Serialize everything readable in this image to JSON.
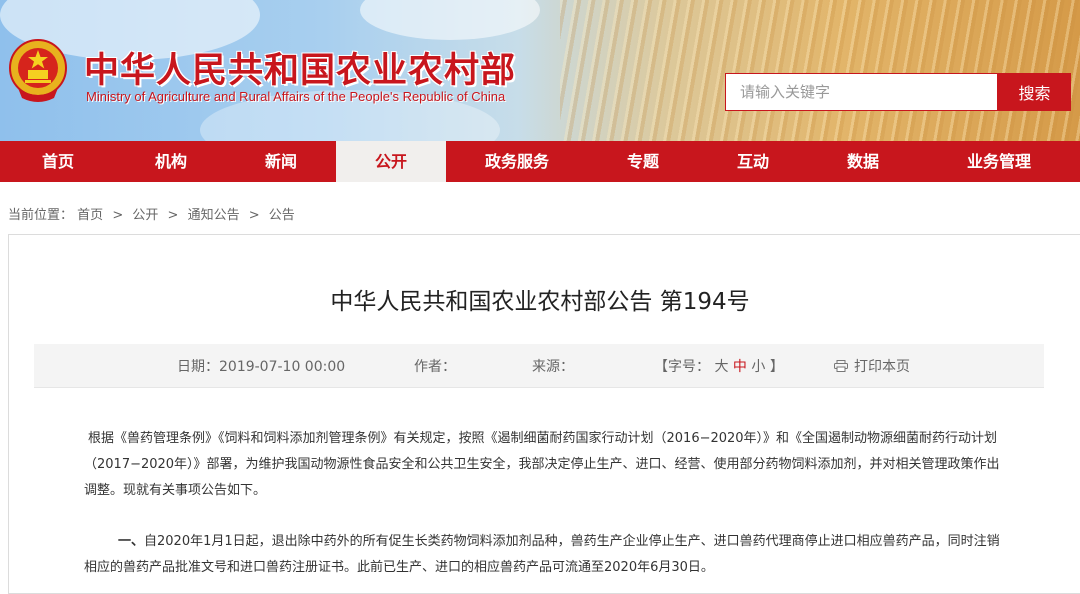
{
  "header": {
    "title": "中华人民共和国农业农村部",
    "subtitle": "Ministry of Agriculture and Rural Affairs of the People's Republic of China",
    "emblem_icon": "national-emblem-icon",
    "search": {
      "placeholder": "请输入关键字",
      "value": "",
      "button_label": "搜索"
    }
  },
  "colors": {
    "brand_red": "#c8161d",
    "nav_active_bg": "#f1efed",
    "meta_bg": "#f4f4f4"
  },
  "nav": {
    "items": [
      {
        "label": "首页",
        "active": false
      },
      {
        "label": "机构",
        "active": false
      },
      {
        "label": "新闻",
        "active": false
      },
      {
        "label": "公开",
        "active": true
      },
      {
        "label": "政务服务",
        "active": false
      },
      {
        "label": "专题",
        "active": false
      },
      {
        "label": "互动",
        "active": false
      },
      {
        "label": "数据",
        "active": false
      },
      {
        "label": "业务管理",
        "active": false
      }
    ]
  },
  "breadcrumb": {
    "prefix": "当前位置：",
    "items": [
      "首页",
      "公开",
      "通知公告",
      "公告"
    ],
    "separator": ">"
  },
  "article": {
    "title": "中华人民共和国农业农村部公告 第194号",
    "meta": {
      "date_label": "日期：2019-07-10 00:00",
      "author_label": "作者：",
      "source_label": "来源：",
      "size_open": "【字号：",
      "size_large": "大",
      "size_medium": "中",
      "size_small": "小",
      "size_close": "】",
      "print_label": "打印本页",
      "print_icon": "printer-icon"
    },
    "paragraphs": [
      {
        "lead": "",
        "text": "根据《兽药管理条例》《饲料和饲料添加剂管理条例》有关规定，按照《遏制细菌耐药国家行动计划（2016−2020年）》和《全国遏制动物源细菌耐药行动计划（2017−2020年）》部署，为维护我国动物源性食品安全和公共卫生安全，我部决定停止生产、进口、经营、使用部分药物饲料添加剂，并对相关管理政策作出调整。现就有关事项公告如下。"
      },
      {
        "lead": "一、",
        "text": "自2020年1月1日起，退出除中药外的所有促生长类药物饲料添加剂品种，兽药生产企业停止生产、进口兽药代理商停止进口相应兽药产品，同时注销相应的兽药产品批准文号和进口兽药注册证书。此前已生产、进口的相应兽药产品可流通至2020年6月30日。"
      }
    ]
  }
}
